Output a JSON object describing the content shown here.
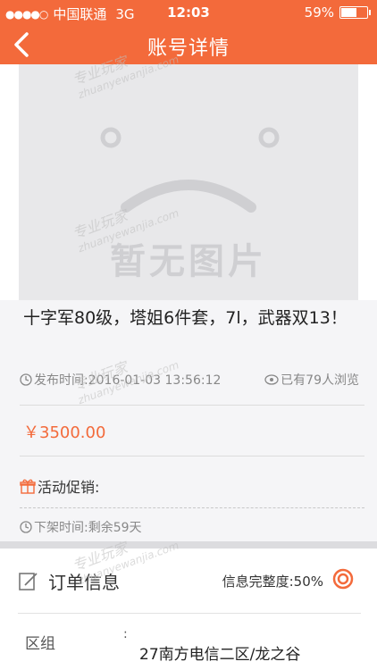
{
  "status_bar": {
    "carrier": "中国联通",
    "network": "3G",
    "time": "12:03",
    "battery": "59%"
  },
  "nav": {
    "title": "账号详情",
    "back_icon": "chevron-left-icon"
  },
  "image": {
    "placeholder_text": "暂无图片"
  },
  "listing": {
    "title": "十字军80级，塔姐6件套，7l，武器双13！",
    "publish_time": "发布时间:2016-01-03 13:56:12",
    "views": "已有79人浏览",
    "price": "￥3500.00",
    "promo_label": "活动促销:",
    "offshelf": "下架时间:剩余59天"
  },
  "order": {
    "title": "订单信息",
    "completeness": "信息完整度:50%",
    "region_label": "区组",
    "region_value": "27南方电信二区/龙之谷"
  },
  "watermark": {
    "text": "专业玩家",
    "url": "zhuanyewanjia.com"
  },
  "colors": {
    "accent": "#f36a3b",
    "background": "#f5f5f7"
  }
}
